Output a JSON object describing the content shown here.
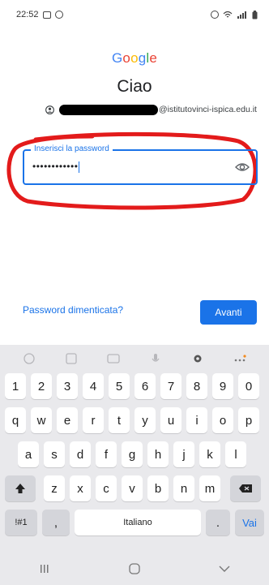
{
  "statusbar": {
    "time": "22:52"
  },
  "logo": {
    "text": "Google",
    "colors": [
      "#4285F4",
      "#EA4335",
      "#FBBC05",
      "#4285F4",
      "#34A853",
      "#EA4335"
    ]
  },
  "greeting": "Ciao",
  "account": {
    "email_suffix": "@istitutovinci-ispica.edu.it"
  },
  "password": {
    "label": "Inserisci la password",
    "value": "••••••••••••"
  },
  "actions": {
    "forgot": "Password dimenticata?",
    "next": "Avanti"
  },
  "keyboard": {
    "row_numbers": [
      "1",
      "2",
      "3",
      "4",
      "5",
      "6",
      "7",
      "8",
      "9",
      "0"
    ],
    "row_1": [
      "q",
      "w",
      "e",
      "r",
      "t",
      "y",
      "u",
      "i",
      "o",
      "p"
    ],
    "row_2": [
      "a",
      "s",
      "d",
      "f",
      "g",
      "h",
      "j",
      "k",
      "l"
    ],
    "row_3": [
      "z",
      "x",
      "c",
      "v",
      "b",
      "n",
      "m"
    ],
    "symbols_key": "!#1",
    "comma_key": ",",
    "space_label": "Italiano",
    "period_key": ".",
    "action_key": "Vai"
  },
  "accent_color": "#1a73e8",
  "highlight_color": "#e31b1b"
}
